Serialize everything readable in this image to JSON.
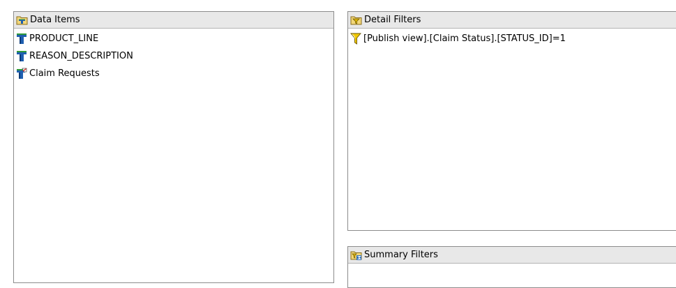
{
  "data_items": {
    "title": "Data Items",
    "icon": "data-items-folder-icon",
    "items": [
      {
        "label": "PRODUCT_LINE",
        "icon": "data-item-icon"
      },
      {
        "label": "REASON_DESCRIPTION",
        "icon": "data-item-icon"
      },
      {
        "label": "Claim Requests",
        "icon": "calculated-data-item-icon"
      }
    ]
  },
  "detail_filters": {
    "title": "Detail Filters",
    "icon": "detail-filters-folder-icon",
    "items": [
      {
        "label": "[Publish view].[Claim Status].[STATUS_ID]=1",
        "icon": "filter-funnel-icon"
      }
    ]
  },
  "summary_filters": {
    "title": "Summary Filters",
    "icon": "summary-filters-folder-icon",
    "items": []
  },
  "colors": {
    "header_bg": "#e8e8e8",
    "border": "#8c8c8c",
    "item_icon_blue": "#1f5fb0",
    "item_icon_green": "#2f9a3a",
    "funnel_yellow": "#e0b800"
  }
}
